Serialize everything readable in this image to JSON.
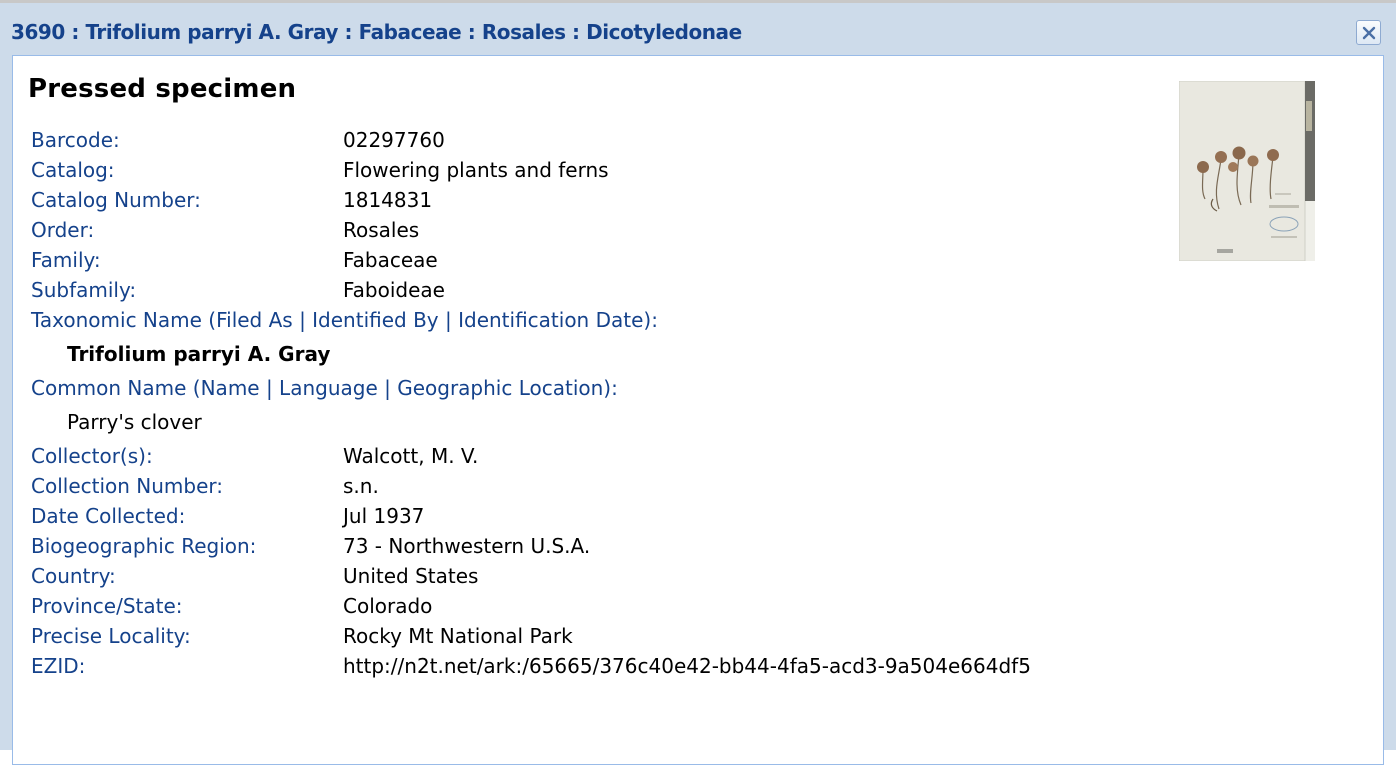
{
  "window": {
    "title": "3690 : Trifolium parryi A. Gray : Fabaceae : Rosales : Dicotyledonae",
    "close_icon": "close-icon"
  },
  "record": {
    "heading": "Pressed specimen",
    "thumbnail_icon": "specimen-thumbnail",
    "fields": [
      {
        "label": "Barcode:",
        "value": "02297760"
      },
      {
        "label": "Catalog:",
        "value": "Flowering plants and ferns"
      },
      {
        "label": "Catalog Number:",
        "value": "1814831"
      },
      {
        "label": "Order:",
        "value": "Rosales"
      },
      {
        "label": "Family:",
        "value": "Fabaceae"
      },
      {
        "label": "Subfamily:",
        "value": "Faboideae"
      }
    ],
    "taxonomic": {
      "label": "Taxonomic Name (Filed As | Identified By | Identification Date):",
      "value": "Trifolium parryi A. Gray"
    },
    "common": {
      "label": "Common Name (Name | Language | Geographic Location):",
      "value": "Parry's clover"
    },
    "fields2": [
      {
        "label": "Collector(s):",
        "value": "Walcott, M. V."
      },
      {
        "label": "Collection Number:",
        "value": "s.n."
      },
      {
        "label": "Date Collected:",
        "value": "Jul 1937"
      },
      {
        "label": "Biogeographic Region:",
        "value": "73 - Northwestern U.S.A."
      },
      {
        "label": "Country:",
        "value": "United States"
      },
      {
        "label": "Province/State:",
        "value": "Colorado"
      },
      {
        "label": "Precise Locality:",
        "value": "Rocky Mt National Park"
      },
      {
        "label": "EZID:",
        "value": "http://n2t.net/ark:/65665/376c40e42-bb44-4fa5-acd3-9a504e664df5"
      }
    ]
  },
  "colors": {
    "label": "#15428b",
    "title": "#15428b",
    "frame": "#cddbea"
  }
}
